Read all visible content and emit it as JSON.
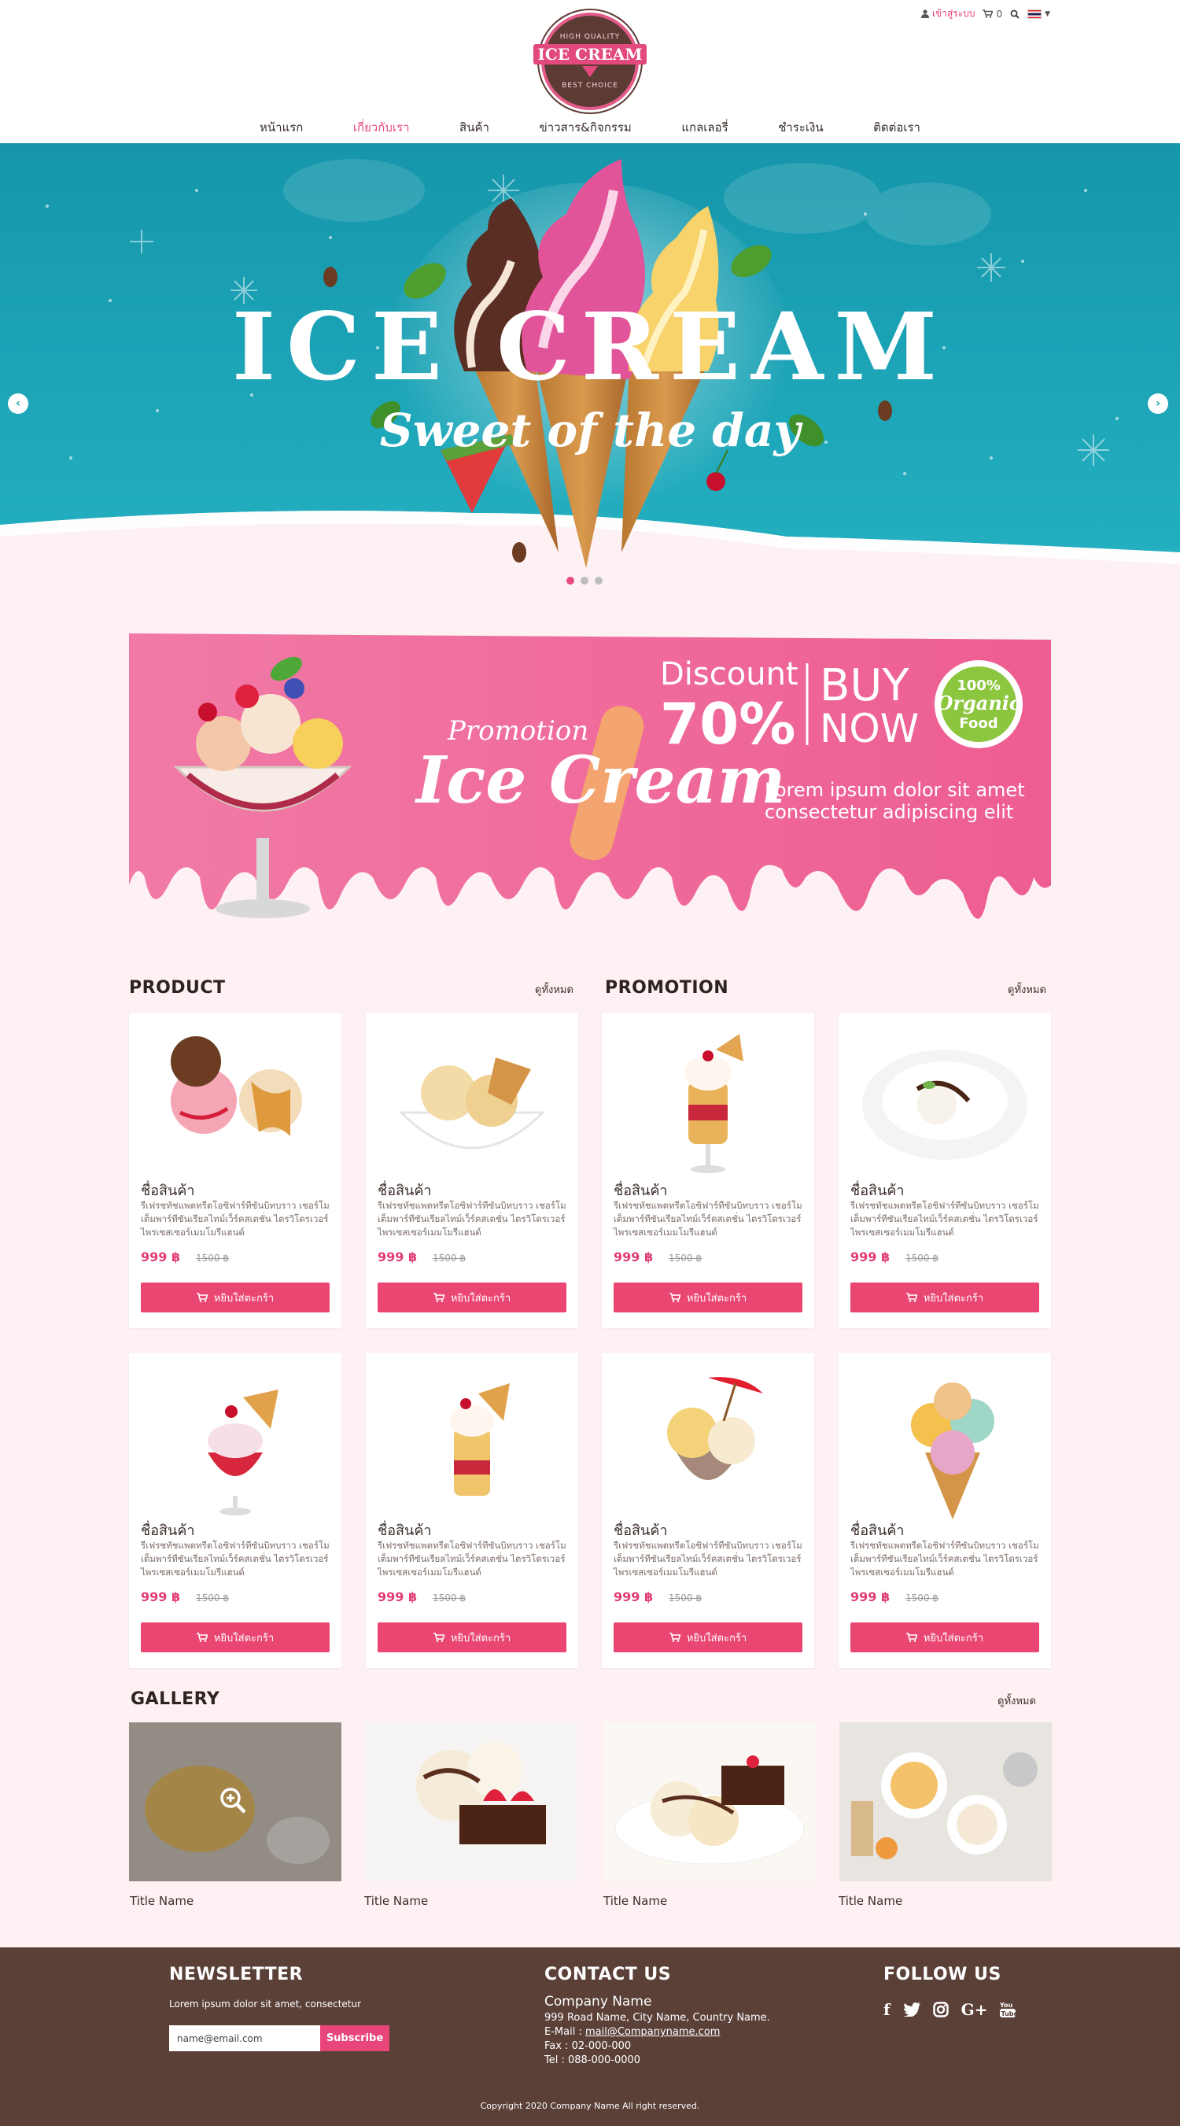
{
  "header": {
    "login": "เข้าสู่ระบบ",
    "cart_count": "0",
    "logo": {
      "ring_top": "HIGH QUALITY",
      "brand": "ICE CREAM",
      "ring_bottom": "BEST CHOICE"
    },
    "nav": [
      "หน้าแรก",
      "เกี่ยวกับเรา",
      "สินค้า",
      "ข่าวสาร&กิจกรรม",
      "แกลเลอรี่",
      "ชำระเงิน",
      "ติดต่อเรา"
    ],
    "nav_active_index": 1
  },
  "hero": {
    "title": "ICE CREAM",
    "subtitle": "Sweet of the day",
    "slide_count": 3,
    "active_slide": 0
  },
  "promo": {
    "discount_label": "Discount",
    "discount_value": "70%",
    "buy": "BUY",
    "now": "NOW",
    "badge_top": "100%",
    "badge_mid": "Organic",
    "badge_bot": "Food",
    "promotion_label": "Promotion",
    "title": "Ice Cream",
    "text_line1": "Lorem ipsum dolor sit amet",
    "text_line2": "consectetur adipiscing elit"
  },
  "sections": {
    "product": "PRODUCT",
    "promotion": "PROMOTION",
    "gallery": "GALLERY",
    "see_all": "ดูทั้งหมด"
  },
  "product_common": {
    "name": "ชื่อสินค้า",
    "desc": "รีเฟรชทัชแพตทรีตโอซิฟาร์ทีซันบิทบราว เชอร์โมเต็มพาร์ทีซันเรียลไทม์เว็ร์คสเตชั่น ไตรวิโดรเวอร์ไพรเซสเซอร์เมมโมรีแฮนด์",
    "price": "999 ฿",
    "old_price": "1500 ฿",
    "button": "หยิบใส่ตะกร้า"
  },
  "product_images": [
    "scoops",
    "bowl-scoops",
    "parfait-glass",
    "white-bowl",
    "sundae-wafer",
    "parfait-wafer",
    "umbrella-sundae",
    "cone-scoops"
  ],
  "gallery": [
    {
      "title": "Title Name"
    },
    {
      "title": "Title Name"
    },
    {
      "title": "Title Name"
    },
    {
      "title": "Title Name"
    }
  ],
  "footer": {
    "newsletter_title": "NEWSLETTER",
    "newsletter_text": "Lorem ipsum dolor sit amet, consectetur",
    "email_value": "name@email.com",
    "subscribe": "Subscribe",
    "contact_title": "CONTACT US",
    "company": "Company Name",
    "address": "999 Road Name, City Name, Country Name.",
    "email_label": "E-Mail : ",
    "email": "mail@Companyname.com",
    "fax": "Fax : 02-000-000",
    "tel": "Tel : 088-000-0000",
    "follow_title": "FOLLOW US",
    "social": [
      "facebook-icon",
      "twitter-icon",
      "instagram-icon",
      "google-plus-icon",
      "youtube-icon"
    ],
    "copyright": "Copyright 2020 Company Name All right reserved."
  },
  "colors": {
    "accent": "#e84a82",
    "hero_bg": "#1a9fb1",
    "footer_bg": "#5b4038",
    "page_bg": "#fdf1f4"
  }
}
